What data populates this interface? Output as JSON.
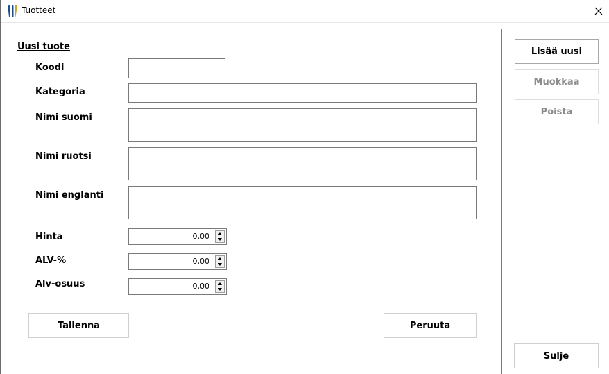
{
  "window": {
    "title": "Tuotteet"
  },
  "form": {
    "section_title": "Uusi tuote",
    "labels": {
      "code": "Koodi",
      "category": "Kategoria",
      "name_fi": "Nimi suomi",
      "name_sv": "Nimi ruotsi",
      "name_en": "Nimi englanti",
      "price": "Hinta",
      "vat_percent": "ALV-%",
      "vat_amount": "Alv-osuus"
    },
    "values": {
      "code": "",
      "category": "",
      "name_fi": "",
      "name_sv": "",
      "name_en": "",
      "price": "0,00",
      "vat_percent": "0,00",
      "vat_amount": "0,00"
    },
    "buttons": {
      "save": "Tallenna",
      "cancel": "Peruuta"
    }
  },
  "sidebar": {
    "buttons": {
      "add_new": "Lisää uusi",
      "edit": "Muokkaa",
      "delete": "Poista",
      "close": "Sulje"
    },
    "disabled": [
      "edit",
      "delete"
    ]
  },
  "icons": {
    "app": "tooth-icon",
    "close": "close-icon",
    "spin_up": "arrow-up-icon",
    "spin_down": "arrow-down-icon"
  }
}
